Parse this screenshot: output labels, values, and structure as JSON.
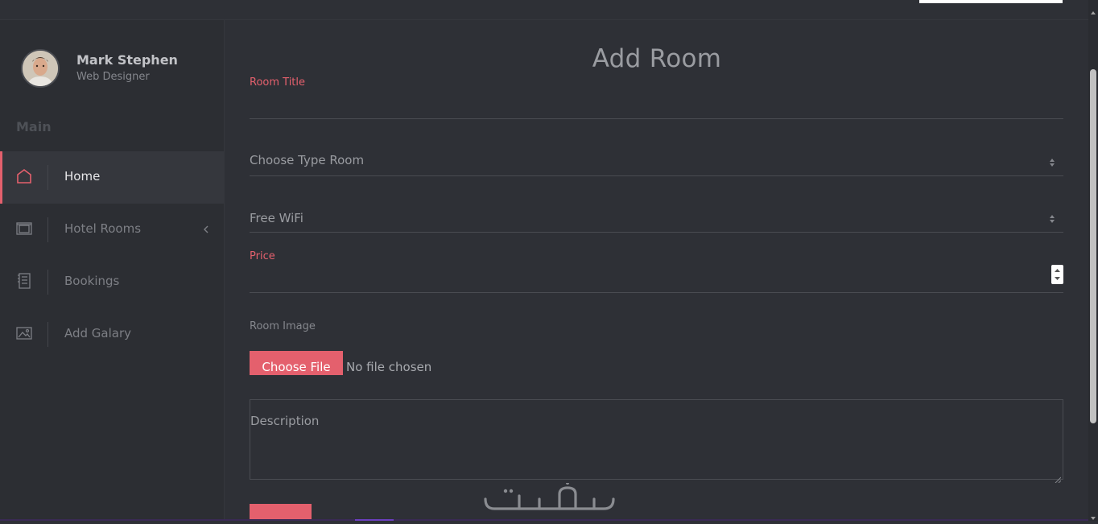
{
  "profile": {
    "name": "Mark Stephen",
    "role": "Web Designer"
  },
  "sidebar": {
    "section_label": "Main",
    "items": [
      {
        "label": "Home",
        "icon": "home-icon",
        "active": true
      },
      {
        "label": "Hotel Rooms",
        "icon": "rooms-icon",
        "active": false,
        "has_submenu": true
      },
      {
        "label": "Bookings",
        "icon": "bookings-icon",
        "active": false
      },
      {
        "label": "Add Galary",
        "icon": "gallery-icon",
        "active": false
      }
    ]
  },
  "form": {
    "title": "Add Room",
    "room_title_label": "Room Title",
    "room_type_selected": "Choose Type Room",
    "wifi_selected": "Free WiFi",
    "price_label": "Price",
    "image_label": "Room Image",
    "file_button": "Choose File",
    "file_status": "No file chosen",
    "description_placeholder": "Description"
  },
  "watermark": {
    "text": "خمسات"
  },
  "colors": {
    "accent": "#e4606d",
    "background": "#2e3036",
    "sidebar": "#2c2e33"
  }
}
